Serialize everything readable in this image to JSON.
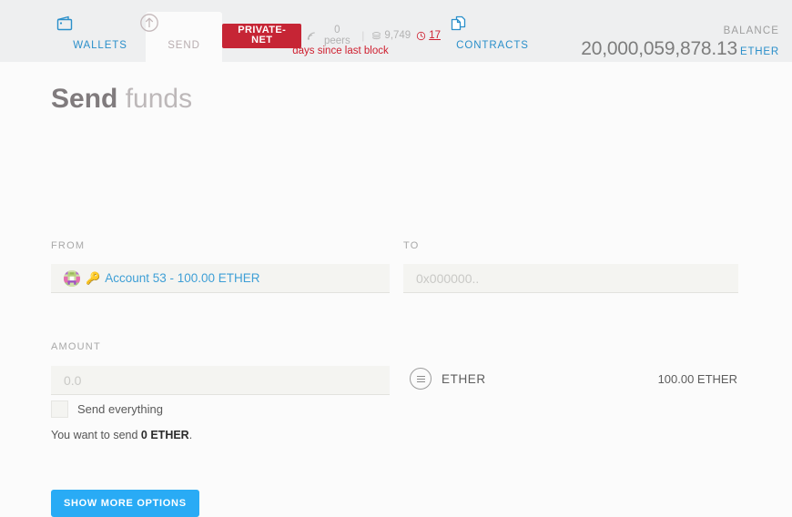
{
  "window": {
    "traffic_lights": [
      "close",
      "minimize",
      "maximize"
    ]
  },
  "header": {
    "tabs": [
      {
        "id": "wallets",
        "label": "WALLETS",
        "icon": "wallet-icon",
        "active": false
      },
      {
        "id": "send",
        "label": "SEND",
        "icon": "send-arrow-icon",
        "active": true
      },
      {
        "id": "contracts",
        "label": "CONTRACTS",
        "icon": "documents-icon",
        "active": false
      }
    ],
    "network": {
      "badge": "PRIVATE-NET",
      "peers": "0 peers",
      "peers_icon": "signal-icon",
      "block_number": "9,749",
      "block_icon": "blocks-icon",
      "time_value": "17",
      "time_icon": "clock-icon",
      "time_caption": "days since last block",
      "divider": "|"
    },
    "balance": {
      "label": "BALANCE",
      "value": "20,000,059,878.13",
      "unit": "ETHER"
    }
  },
  "page": {
    "title_strong": "Send",
    "title_light": " funds"
  },
  "form": {
    "from": {
      "label": "FROM",
      "avatar_icon": "identicon-avatar",
      "key_icon": "key-icon",
      "account_text": "Account 53 - 100.00 ETHER"
    },
    "to": {
      "label": "TO",
      "value": "",
      "placeholder": "0x000000.."
    },
    "amount": {
      "label": "AMOUNT",
      "value": "",
      "placeholder": "0.0"
    },
    "send_everything": {
      "label": "Send everything",
      "checked": false
    },
    "summary_prefix": "You want to send ",
    "summary_amount": "0 ETHER",
    "summary_suffix": ".",
    "currency": {
      "icon": "list-circle-icon",
      "name": "ETHER",
      "available": "100.00 ETHER"
    },
    "show_more_button": "SHOW MORE OPTIONS"
  },
  "colors": {
    "accent_blue": "#29abf5",
    "link_blue": "#2a8fca",
    "alert_red": "#cf2030",
    "badge_red": "#c62535",
    "header_bg": "#eeeff0",
    "body_bg": "#fbfbfb",
    "field_bg": "#f4f4f1"
  }
}
